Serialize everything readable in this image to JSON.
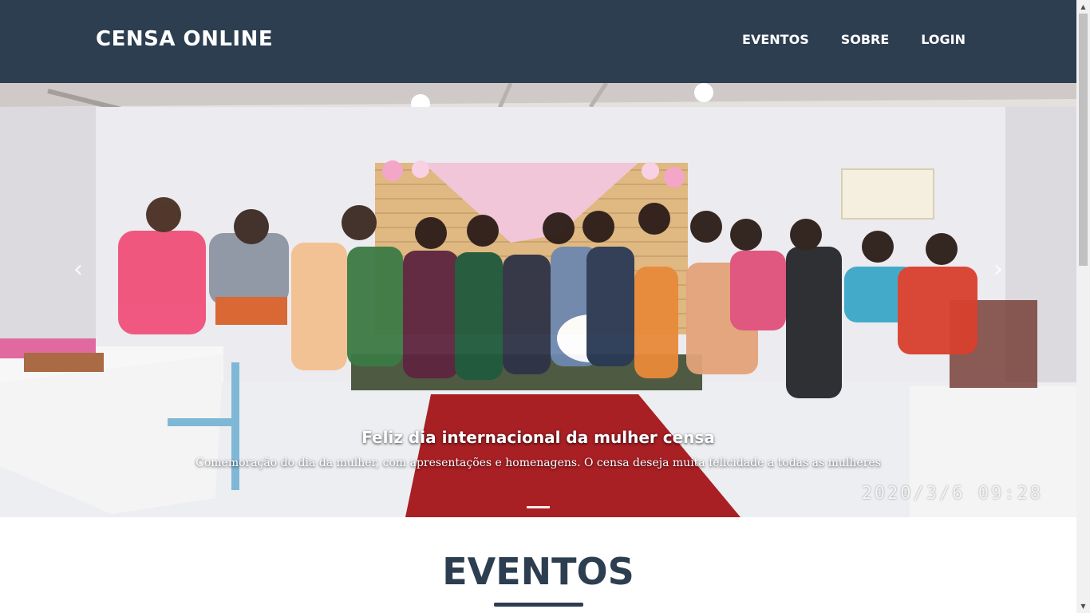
{
  "navbar": {
    "brand": "CENSA ONLINE",
    "links": {
      "eventos": "EVENTOS",
      "sobre": "SOBRE",
      "login": "LOGIN"
    },
    "bg_color": "#2c3e50"
  },
  "carousel": {
    "caption_title": "Feliz dia internacional da mulher censa",
    "caption_text": "Comemoração do dia da mulher, com apresentações e homenagens. O censa deseja muita felicidade a todas as mulheres",
    "photo_timestamp": "2020/3/6  09:28",
    "prev_icon": "chevron-left-icon",
    "next_icon": "chevron-right-icon",
    "prev_glyph": "‹",
    "next_glyph": "›",
    "slides_count": 1,
    "active_slide": 1
  },
  "section": {
    "title": "EVENTOS"
  },
  "scrollbar": {
    "up_glyph": "▲",
    "down_glyph": "▼"
  }
}
